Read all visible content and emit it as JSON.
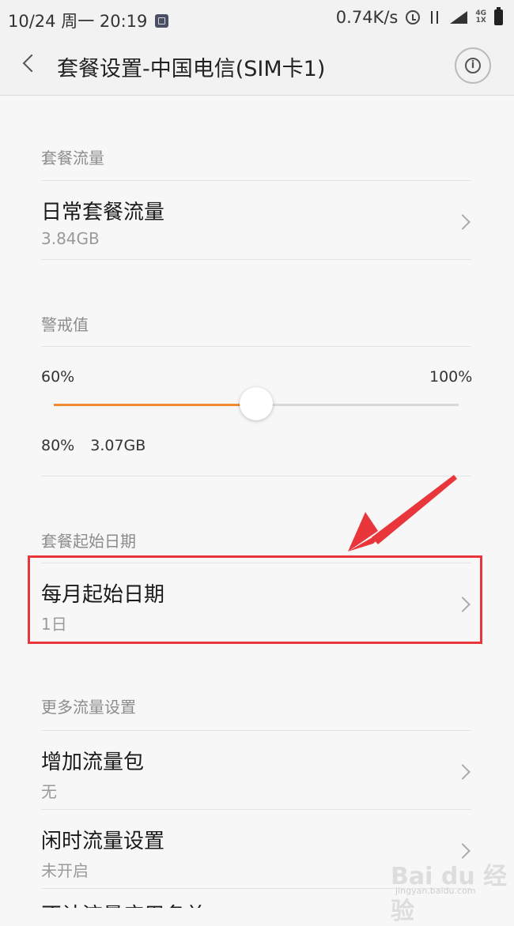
{
  "status_bar": {
    "datetime": "10/24 周一 20:19",
    "net_speed": "0.74K/s",
    "network_type_top": "4G",
    "network_type_bottom": "1X"
  },
  "header": {
    "title": "套餐设置-中国电信(SIM卡1)"
  },
  "sections": {
    "plan_data": {
      "header": "套餐流量",
      "item": {
        "title": "日常套餐流量",
        "value": "3.84GB"
      }
    },
    "warning": {
      "header": "警戒值",
      "slider_min": "60%",
      "slider_max": "100%",
      "slider_level": 0.5,
      "current_percent": "80%",
      "current_amount": "3.07GB"
    },
    "start_date": {
      "header": "套餐起始日期",
      "item": {
        "title": "每月起始日期",
        "value": "1日"
      }
    },
    "more": {
      "header": "更多流量设置",
      "items": [
        {
          "title": "增加流量包",
          "value": "无"
        },
        {
          "title": "闲时流量设置",
          "value": "未开启"
        },
        {
          "title": "不计流量应用名单"
        }
      ]
    }
  },
  "colors": {
    "accent": "#f08a33",
    "highlight": "#e8363b"
  },
  "watermark": {
    "brand": "Bai du 经验",
    "url": "jingyan.baidu.com"
  }
}
